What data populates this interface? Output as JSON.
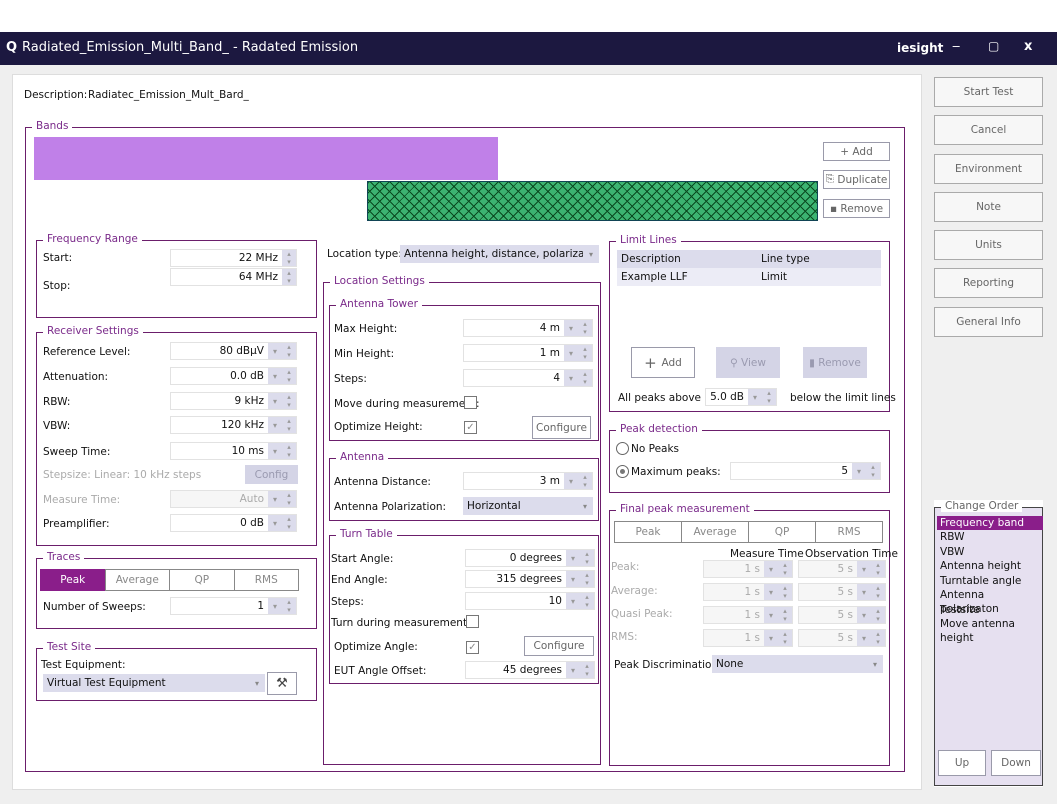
{
  "window": {
    "title": "Radiated_Emission_Multi_Band_ - Radated Emission",
    "logo": "iesight",
    "min": "‒",
    "max": "▢",
    "close": "x"
  },
  "description": {
    "label": "Description:",
    "value": "Radiatec_Emission_Mult_Bard_"
  },
  "bands": {
    "title": "Bands",
    "band_color": "#c080e8",
    "hatch_color": "#3cb371",
    "add": "+ Add",
    "duplicate": "Duplicate",
    "remove": "Remove"
  },
  "frequency_range": {
    "title": "Frequency Range",
    "start_label": "Start:",
    "start": "22 MHz",
    "stop_label": "Stop:",
    "stop": "64 MHz"
  },
  "receiver": {
    "title": "Receiver Settings",
    "rows": [
      {
        "label": "Reference Level:",
        "value": "80 dBµV"
      },
      {
        "label": "Attenuation:",
        "value": "0.0 dB"
      },
      {
        "label": "RBW:",
        "value": "9 kHz"
      },
      {
        "label": "VBW:",
        "value": "120 kHz"
      },
      {
        "label": "Sweep Time:",
        "value": "10 ms"
      }
    ],
    "stepsize": "Stepsize: Linear: 10 kHz steps",
    "config": "Config",
    "measure_time_label": "Measure Time:",
    "measure_time": "Auto",
    "preamp_label": "Preamplifier:",
    "preamp": "0 dB"
  },
  "traces": {
    "title": "Traces",
    "tabs": [
      "Peak",
      "Average",
      "QP",
      "RMS"
    ],
    "sweeps_label": "Number of Sweeps:",
    "sweeps": "1"
  },
  "test_site": {
    "title": "Test Site",
    "equipment_label": "Test Equipment:",
    "equipment": "Virtual Test Equipment"
  },
  "location": {
    "type_label": "Location type:",
    "type": "Antenna height, distance, polarizatio...",
    "title": "Location Settings"
  },
  "tower": {
    "title": "Antenna Tower",
    "max_label": "Max Height:",
    "max": "4 m",
    "min_label": "Min Height:",
    "min": "1 m",
    "steps_label": "Steps:",
    "steps": "4",
    "move_label": "Move during measurement:",
    "move": false,
    "opt_label": "Optimize Height:",
    "opt": true,
    "configure": "Configure"
  },
  "antenna": {
    "title": "Antenna",
    "dist_label": "Antenna Distance:",
    "dist": "3 m",
    "pol_label": "Antenna Polarization:",
    "pol": "Horizontal"
  },
  "turntable": {
    "title": "Turn Table",
    "start_label": "Start Angle:",
    "start": "0 degrees",
    "end_label": "End Angle:",
    "end": "315 degrees",
    "steps_label": "Steps:",
    "steps": "10",
    "turn_label": "Turn during measurement:",
    "turn": false,
    "opt_label": "Optimize Angle:",
    "opt": true,
    "configure": "Configure",
    "offset_label": "EUT Angle Offset:",
    "offset": "45 degrees"
  },
  "limit_lines": {
    "title": "Limit Lines",
    "col_desc": "Description",
    "col_type": "Line type",
    "rows": [
      {
        "desc": "Example LLF",
        "type": "Limit"
      }
    ],
    "add": "Add",
    "view": "View",
    "remove": "Remove",
    "peaks_above": "All peaks above",
    "peaks_value": "5.0 dB",
    "below": "below the limit lines"
  },
  "peak_detection": {
    "title": "Peak detection",
    "no_peaks": "No Peaks",
    "max_peaks": "Maximum peaks:",
    "max_value": "5",
    "selected": "max"
  },
  "final_peak": {
    "title": "Final peak measurement",
    "tabs": [
      "Peak",
      "Average",
      "QP",
      "RMS"
    ],
    "col_measure": "Measure Time",
    "col_obs": "Observation Time",
    "rows": [
      {
        "label": "Peak:",
        "measure": "1 s",
        "obs": "5 s"
      },
      {
        "label": "Average:",
        "measure": "1 s",
        "obs": "5 s"
      },
      {
        "label": "Quasi Peak:",
        "measure": "1 s",
        "obs": "5 s"
      },
      {
        "label": "RMS:",
        "measure": "1 s",
        "obs": "5 s"
      }
    ],
    "disc_label": "Peak Discrimination:",
    "disc": "None"
  },
  "sidebar": {
    "buttons": [
      "Start Test",
      "Cancel",
      "Environment",
      "Note",
      "Units",
      "Reporting",
      "General Info"
    ],
    "change_order": {
      "title": "Change Order",
      "items": [
        "Frequency band",
        "RBW",
        "VBW",
        "Antenna height",
        "Turntable angle",
        "Antenna polarizaton",
        "Testsite",
        "Move antenna height"
      ],
      "selected": 0,
      "up": "Up",
      "down": "Down"
    }
  }
}
